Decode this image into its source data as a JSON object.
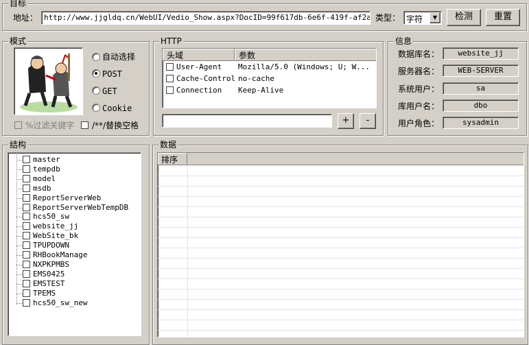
{
  "target": {
    "title": "目标",
    "address_label": "地址：",
    "address_value": "http://www.jjgldq.cn/WebUI/Vedio_Show.aspx?DocID=99f617db-6e6f-419f-af2a-9fe7850",
    "type_label": "类型：",
    "type_value": "字符",
    "detect_button": "检测",
    "reset_button": "重置"
  },
  "mode": {
    "title": "模式",
    "options": [
      {
        "label": "自动选择",
        "selected": false
      },
      {
        "label": "POST",
        "selected": true
      },
      {
        "label": "GET",
        "selected": false
      },
      {
        "label": "Cookie",
        "selected": false
      }
    ],
    "filter_keywords": "%过滤关键字",
    "replace_spaces": "/**/替换空格"
  },
  "http": {
    "title": "HTTP",
    "columns": [
      "头域",
      "参数"
    ],
    "rows": [
      {
        "header": "User-Agent",
        "value": "Mozilla/5.0 (Windows; U; W..."
      },
      {
        "header": "Cache-Control",
        "value": "no-cache"
      },
      {
        "header": "Connection",
        "value": "Keep-Alive"
      }
    ],
    "add_button": "+",
    "remove_button": "-",
    "input_value": ""
  },
  "info": {
    "title": "信息",
    "fields": [
      {
        "label": "数据库名：",
        "value": "website_jj"
      },
      {
        "label": "服务器名：",
        "value": "WEB-SERVER"
      },
      {
        "label": "系统用户：",
        "value": "sa"
      },
      {
        "label": "库用户名：",
        "value": "dbo"
      },
      {
        "label": "用户角色：",
        "value": "sysadmin"
      }
    ]
  },
  "structure": {
    "title": "结构",
    "databases": [
      "master",
      "tempdb",
      "model",
      "msdb",
      "ReportServerWeb",
      "ReportServerWebTempDB",
      "hcs50_sw",
      "website_jj",
      "WebSite_bk",
      "TPUPDOWN",
      "RHBookManage",
      "NXPKPMBS",
      "EMS0425",
      "EMSTEST",
      "TPEMS",
      "hcs50_sw_new"
    ]
  },
  "data_panel": {
    "title": "数据",
    "column": "排序"
  }
}
